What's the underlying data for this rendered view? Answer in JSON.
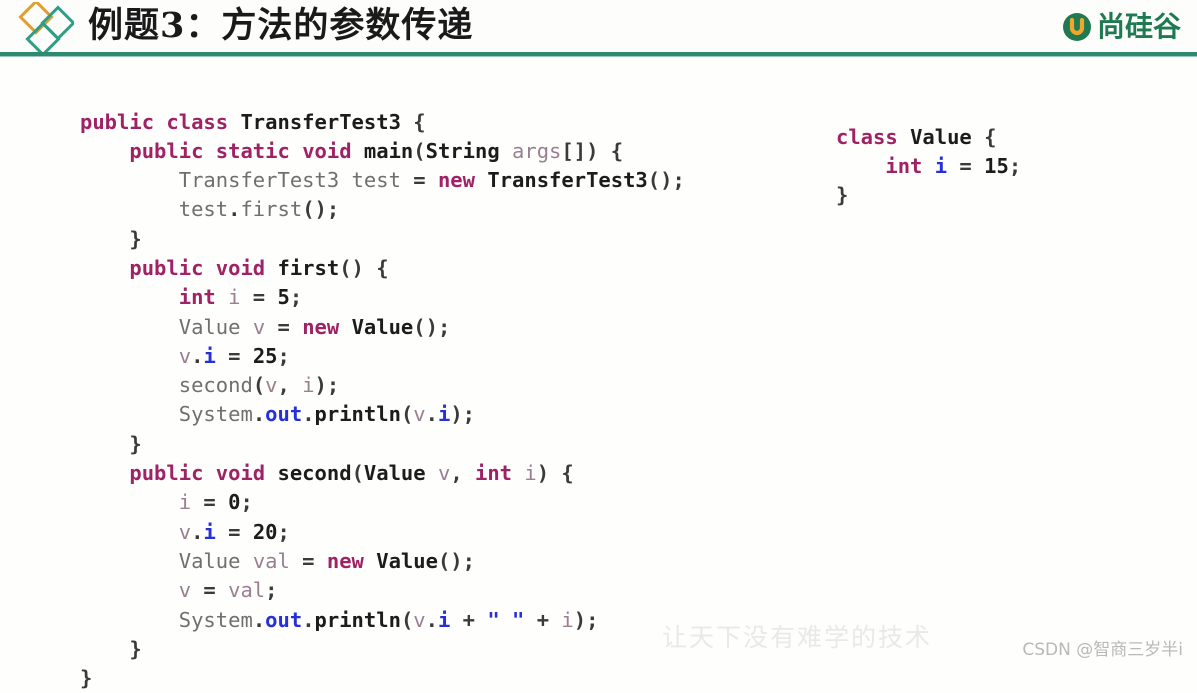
{
  "header": {
    "title": "例题3：方法的参数传递",
    "logo_icon": "diamond-cluster-icon",
    "brand": {
      "mark_icon": "u-circle-icon",
      "mark_letter": "U",
      "name": "尚硅谷",
      "color": "#1f7a52"
    },
    "rule_color": "#2f8a72"
  },
  "code_main": {
    "language": "java",
    "lines": [
      [
        {
          "t": "public",
          "c": "kw"
        },
        {
          "t": " ",
          "c": "pun"
        },
        {
          "t": "class",
          "c": "kw"
        },
        {
          "t": " ",
          "c": "pun"
        },
        {
          "t": "TransferTest3",
          "c": "typ"
        },
        {
          "t": " ",
          "c": "pun"
        },
        {
          "t": "{",
          "c": "pun"
        }
      ],
      [
        {
          "t": "    ",
          "c": "pun"
        },
        {
          "t": "public",
          "c": "kw"
        },
        {
          "t": " ",
          "c": "pun"
        },
        {
          "t": "static",
          "c": "kw"
        },
        {
          "t": " ",
          "c": "pun"
        },
        {
          "t": "void",
          "c": "kw"
        },
        {
          "t": " ",
          "c": "pun"
        },
        {
          "t": "main",
          "c": "typ"
        },
        {
          "t": "(",
          "c": "pun"
        },
        {
          "t": "String",
          "c": "typ"
        },
        {
          "t": " ",
          "c": "pun"
        },
        {
          "t": "args",
          "c": "var"
        },
        {
          "t": "[]) {",
          "c": "pun"
        }
      ],
      [
        {
          "t": "        ",
          "c": "pun"
        },
        {
          "t": "TransferTest3",
          "c": "id"
        },
        {
          "t": " ",
          "c": "pun"
        },
        {
          "t": "test",
          "c": "id"
        },
        {
          "t": " = ",
          "c": "pun"
        },
        {
          "t": "new",
          "c": "kw"
        },
        {
          "t": " ",
          "c": "pun"
        },
        {
          "t": "TransferTest3",
          "c": "typ"
        },
        {
          "t": "();",
          "c": "pun"
        }
      ],
      [
        {
          "t": "        ",
          "c": "pun"
        },
        {
          "t": "test",
          "c": "id"
        },
        {
          "t": ".",
          "c": "pun"
        },
        {
          "t": "first",
          "c": "id"
        },
        {
          "t": "();",
          "c": "pun"
        }
      ],
      [
        {
          "t": "    ",
          "c": "pun"
        },
        {
          "t": "}",
          "c": "pun"
        }
      ],
      [
        {
          "t": "    ",
          "c": "pun"
        },
        {
          "t": "public",
          "c": "kw"
        },
        {
          "t": " ",
          "c": "pun"
        },
        {
          "t": "void",
          "c": "kw"
        },
        {
          "t": " ",
          "c": "pun"
        },
        {
          "t": "first",
          "c": "typ"
        },
        {
          "t": "() {",
          "c": "pun"
        }
      ],
      [
        {
          "t": "        ",
          "c": "pun"
        },
        {
          "t": "int",
          "c": "kw"
        },
        {
          "t": " ",
          "c": "pun"
        },
        {
          "t": "i",
          "c": "var"
        },
        {
          "t": " = ",
          "c": "pun"
        },
        {
          "t": "5",
          "c": "num"
        },
        {
          "t": ";",
          "c": "pun"
        }
      ],
      [
        {
          "t": "        ",
          "c": "pun"
        },
        {
          "t": "Value",
          "c": "id"
        },
        {
          "t": " ",
          "c": "pun"
        },
        {
          "t": "v",
          "c": "var"
        },
        {
          "t": " = ",
          "c": "pun"
        },
        {
          "t": "new",
          "c": "kw"
        },
        {
          "t": " ",
          "c": "pun"
        },
        {
          "t": "Value",
          "c": "typ"
        },
        {
          "t": "();",
          "c": "pun"
        }
      ],
      [
        {
          "t": "        ",
          "c": "pun"
        },
        {
          "t": "v",
          "c": "var"
        },
        {
          "t": ".",
          "c": "pun"
        },
        {
          "t": "i",
          "c": "fld"
        },
        {
          "t": " = ",
          "c": "pun"
        },
        {
          "t": "25",
          "c": "num"
        },
        {
          "t": ";",
          "c": "pun"
        }
      ],
      [
        {
          "t": "        ",
          "c": "pun"
        },
        {
          "t": "second",
          "c": "id"
        },
        {
          "t": "(",
          "c": "pun"
        },
        {
          "t": "v",
          "c": "var"
        },
        {
          "t": ", ",
          "c": "pun"
        },
        {
          "t": "i",
          "c": "var"
        },
        {
          "t": ");",
          "c": "pun"
        }
      ],
      [
        {
          "t": "        ",
          "c": "pun"
        },
        {
          "t": "System",
          "c": "id"
        },
        {
          "t": ".",
          "c": "pun"
        },
        {
          "t": "out",
          "c": "fld"
        },
        {
          "t": ".",
          "c": "pun"
        },
        {
          "t": "println",
          "c": "typ"
        },
        {
          "t": "(",
          "c": "pun"
        },
        {
          "t": "v",
          "c": "var"
        },
        {
          "t": ".",
          "c": "pun"
        },
        {
          "t": "i",
          "c": "fld"
        },
        {
          "t": ");",
          "c": "pun"
        }
      ],
      [
        {
          "t": "    ",
          "c": "pun"
        },
        {
          "t": "}",
          "c": "pun"
        }
      ],
      [
        {
          "t": "    ",
          "c": "pun"
        },
        {
          "t": "public",
          "c": "kw"
        },
        {
          "t": " ",
          "c": "pun"
        },
        {
          "t": "void",
          "c": "kw"
        },
        {
          "t": " ",
          "c": "pun"
        },
        {
          "t": "second",
          "c": "typ"
        },
        {
          "t": "(",
          "c": "pun"
        },
        {
          "t": "Value",
          "c": "typ"
        },
        {
          "t": " ",
          "c": "pun"
        },
        {
          "t": "v",
          "c": "var"
        },
        {
          "t": ", ",
          "c": "pun"
        },
        {
          "t": "int",
          "c": "kw"
        },
        {
          "t": " ",
          "c": "pun"
        },
        {
          "t": "i",
          "c": "var"
        },
        {
          "t": ") {",
          "c": "pun"
        }
      ],
      [
        {
          "t": "        ",
          "c": "pun"
        },
        {
          "t": "i",
          "c": "var"
        },
        {
          "t": " = ",
          "c": "pun"
        },
        {
          "t": "0",
          "c": "num"
        },
        {
          "t": ";",
          "c": "pun"
        }
      ],
      [
        {
          "t": "        ",
          "c": "pun"
        },
        {
          "t": "v",
          "c": "var"
        },
        {
          "t": ".",
          "c": "pun"
        },
        {
          "t": "i",
          "c": "fld"
        },
        {
          "t": " = ",
          "c": "pun"
        },
        {
          "t": "20",
          "c": "num"
        },
        {
          "t": ";",
          "c": "pun"
        }
      ],
      [
        {
          "t": "        ",
          "c": "pun"
        },
        {
          "t": "Value",
          "c": "id"
        },
        {
          "t": " ",
          "c": "pun"
        },
        {
          "t": "val",
          "c": "var"
        },
        {
          "t": " = ",
          "c": "pun"
        },
        {
          "t": "new",
          "c": "kw"
        },
        {
          "t": " ",
          "c": "pun"
        },
        {
          "t": "Value",
          "c": "typ"
        },
        {
          "t": "();",
          "c": "pun"
        }
      ],
      [
        {
          "t": "        ",
          "c": "pun"
        },
        {
          "t": "v",
          "c": "var"
        },
        {
          "t": " = ",
          "c": "pun"
        },
        {
          "t": "val",
          "c": "var"
        },
        {
          "t": ";",
          "c": "pun"
        }
      ],
      [
        {
          "t": "        ",
          "c": "pun"
        },
        {
          "t": "System",
          "c": "id"
        },
        {
          "t": ".",
          "c": "pun"
        },
        {
          "t": "out",
          "c": "fld"
        },
        {
          "t": ".",
          "c": "pun"
        },
        {
          "t": "println",
          "c": "typ"
        },
        {
          "t": "(",
          "c": "pun"
        },
        {
          "t": "v",
          "c": "var"
        },
        {
          "t": ".",
          "c": "pun"
        },
        {
          "t": "i",
          "c": "fld"
        },
        {
          "t": " + ",
          "c": "pun"
        },
        {
          "t": "\" \"",
          "c": "str"
        },
        {
          "t": " + ",
          "c": "pun"
        },
        {
          "t": "i",
          "c": "var"
        },
        {
          "t": ");",
          "c": "pun"
        }
      ],
      [
        {
          "t": "    ",
          "c": "pun"
        },
        {
          "t": "}",
          "c": "pun"
        }
      ],
      [
        {
          "t": "}",
          "c": "pun"
        }
      ]
    ]
  },
  "code_value": {
    "language": "java",
    "lines": [
      [
        {
          "t": "class",
          "c": "kw"
        },
        {
          "t": " ",
          "c": "pun"
        },
        {
          "t": "Value",
          "c": "typ"
        },
        {
          "t": " ",
          "c": "pun"
        },
        {
          "t": "{",
          "c": "pun"
        }
      ],
      [
        {
          "t": "    ",
          "c": "pun"
        },
        {
          "t": "int",
          "c": "kw"
        },
        {
          "t": " ",
          "c": "pun"
        },
        {
          "t": "i",
          "c": "fld"
        },
        {
          "t": " = ",
          "c": "pun"
        },
        {
          "t": "15",
          "c": "num"
        },
        {
          "t": ";",
          "c": "pun"
        }
      ],
      [
        {
          "t": "}",
          "c": "pun"
        }
      ]
    ]
  },
  "watermarks": {
    "slogan": "让天下没有难学的技术",
    "csdn": "CSDN @智商三岁半i"
  }
}
